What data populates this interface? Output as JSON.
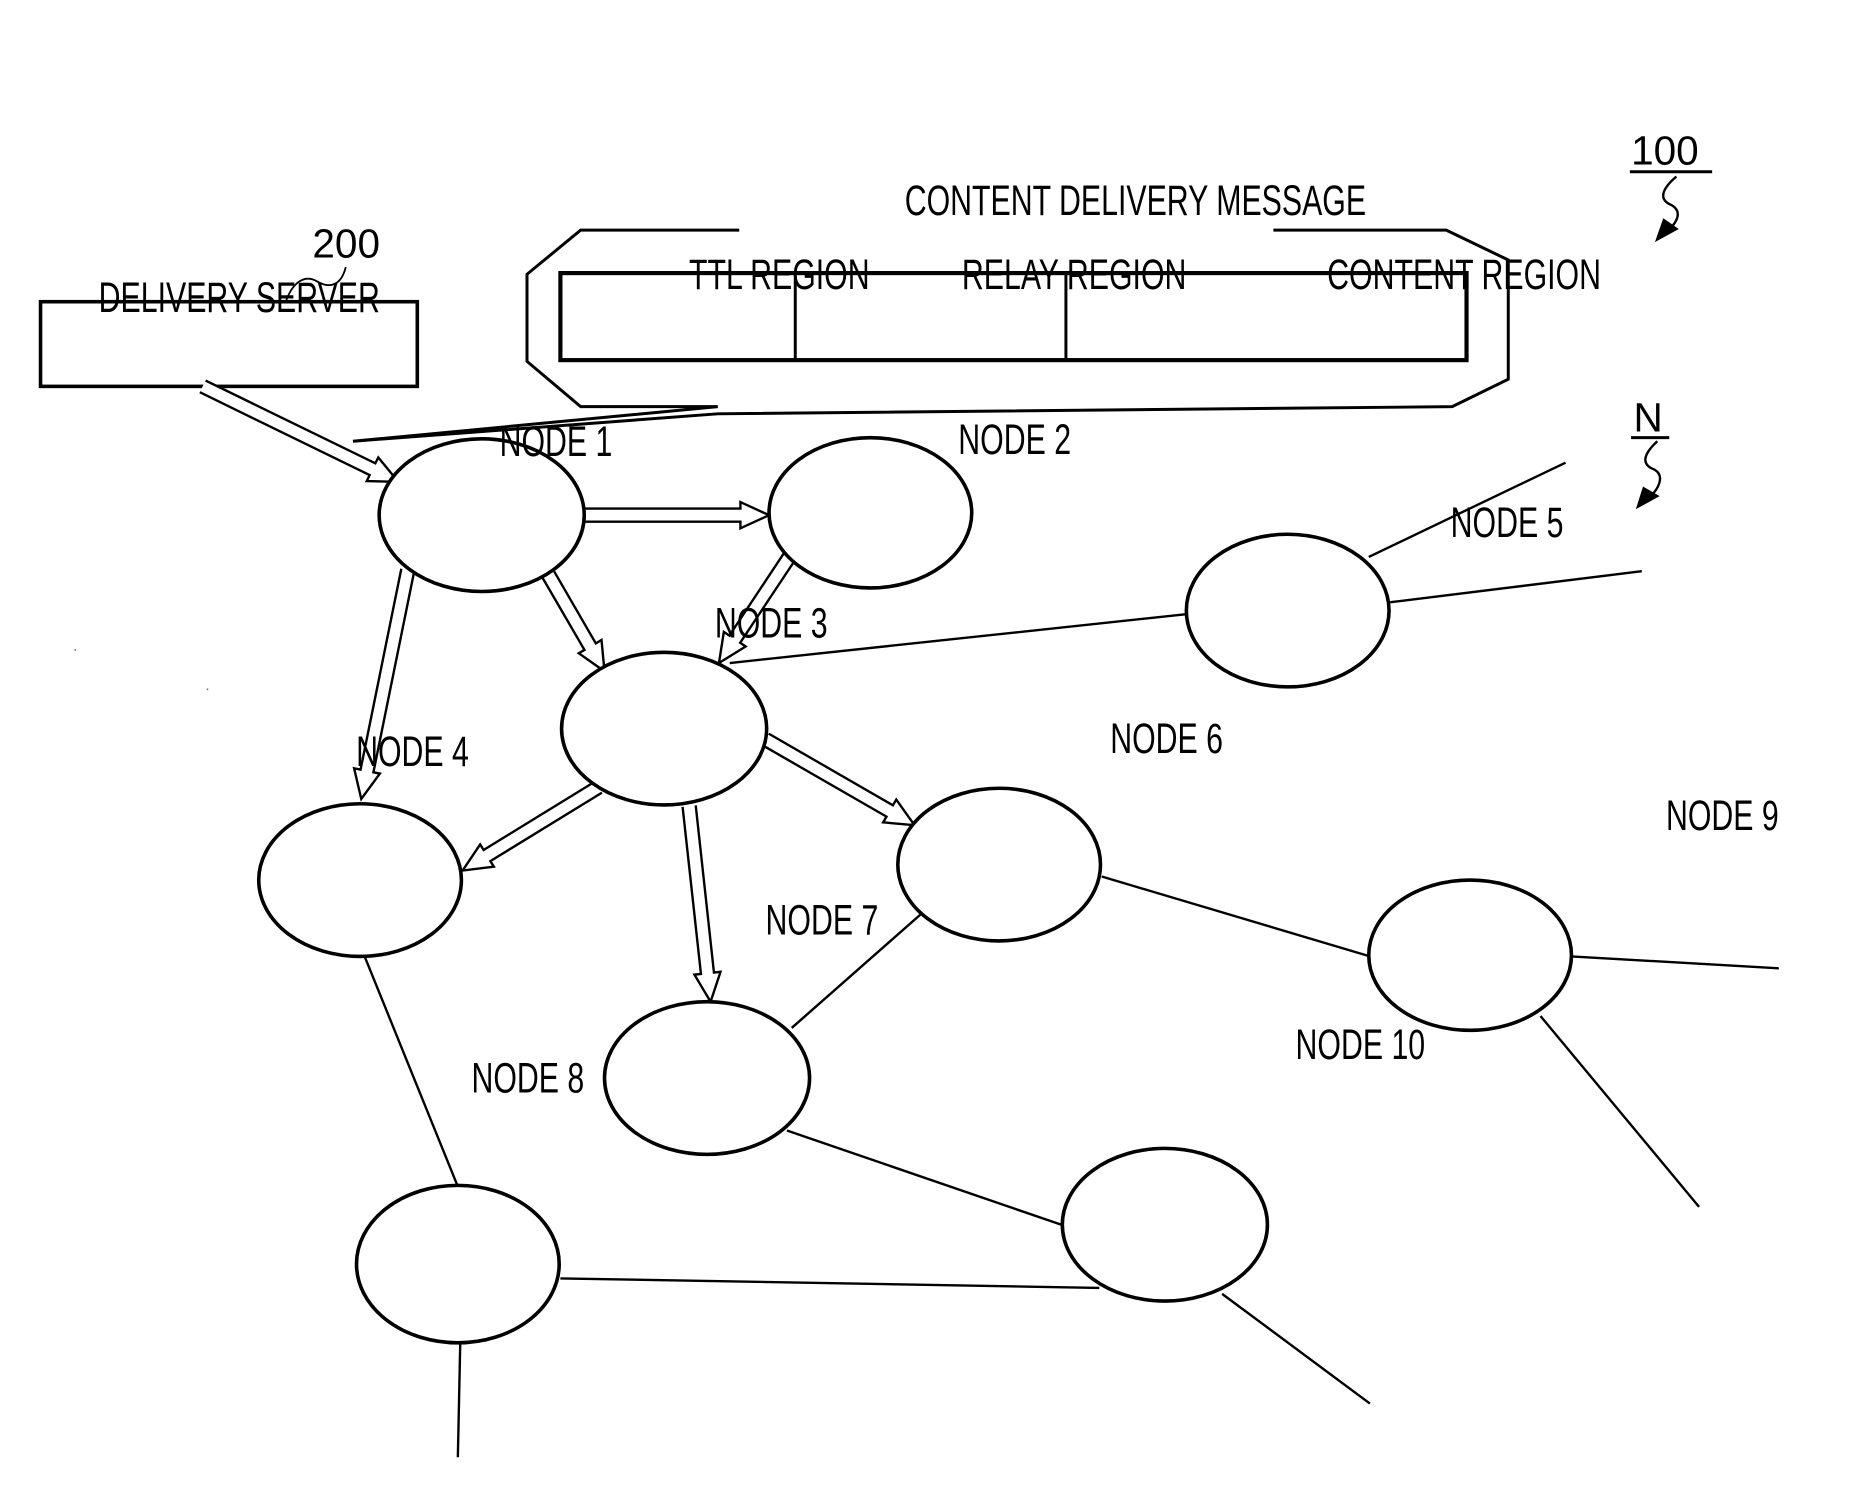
{
  "figure": {
    "system_ref": "100",
    "network_ref": "N",
    "server_ref": "200"
  },
  "delivery_server": {
    "label": "DELIVERY SERVER"
  },
  "message": {
    "title": "CONTENT DELIVERY MESSAGE",
    "regions": [
      "TTL REGION",
      "RELAY REGION",
      "CONTENT REGION"
    ]
  },
  "nodes": [
    {
      "id": "n1",
      "label": "NODE 1"
    },
    {
      "id": "n2",
      "label": "NODE 2"
    },
    {
      "id": "n3",
      "label": "NODE 3"
    },
    {
      "id": "n4",
      "label": "NODE 4"
    },
    {
      "id": "n5",
      "label": "NODE 5"
    },
    {
      "id": "n6",
      "label": "NODE 6"
    },
    {
      "id": "n7",
      "label": "NODE 7"
    },
    {
      "id": "n8",
      "label": "NODE 8"
    },
    {
      "id": "n9",
      "label": "NODE 9"
    },
    {
      "id": "n10",
      "label": "NODE 10"
    }
  ],
  "delivery_arrows": [
    {
      "from": "server",
      "to": "n1"
    },
    {
      "from": "n1",
      "to": "n2"
    },
    {
      "from": "n1",
      "to": "n3"
    },
    {
      "from": "n1",
      "to": "n4"
    },
    {
      "from": "n2",
      "to": "n3"
    },
    {
      "from": "n3",
      "to": "n4"
    },
    {
      "from": "n3",
      "to": "n6"
    },
    {
      "from": "n3",
      "to": "n7"
    }
  ],
  "links": [
    {
      "from": "n3",
      "to": "n5"
    },
    {
      "from": "n5",
      "to": "out"
    },
    {
      "from": "n5",
      "to": "out"
    },
    {
      "from": "n6",
      "to": "n7"
    },
    {
      "from": "n6",
      "to": "n9"
    },
    {
      "from": "n9",
      "to": "out"
    },
    {
      "from": "n9",
      "to": "out"
    },
    {
      "from": "n4",
      "to": "n8"
    },
    {
      "from": "n7",
      "to": "n10"
    },
    {
      "from": "n8",
      "to": "n10"
    },
    {
      "from": "n8",
      "to": "out"
    },
    {
      "from": "n10",
      "to": "out"
    }
  ]
}
